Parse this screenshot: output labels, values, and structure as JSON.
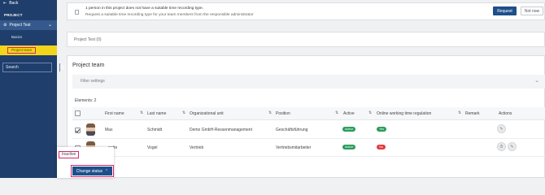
{
  "sidebar": {
    "back_label": "Back",
    "section_label": "PROJECT",
    "project_label": "Project Test",
    "basics_label": "Basics",
    "team_label": "Project team",
    "search_placeholder": "Search"
  },
  "notice": {
    "title": "1 person in this project does not have a suitable time recording type.",
    "text": "Request a suitable time recording type for your team members from the responsible administrator",
    "request_label": "Request",
    "not_now_label": "Not now"
  },
  "project_text": {
    "label": "Project Text (0)"
  },
  "team": {
    "title": "Project team",
    "filter_label": "Filter settings",
    "elements_label": "Elements: 2",
    "columns": {
      "first_name": "First name",
      "last_name": "Last name",
      "org_unit": "Organizational unit",
      "position": "Position",
      "active": "Active",
      "online_working_time": "Online working time regulation",
      "remark": "Remark",
      "actions": "Actions"
    },
    "rows": [
      {
        "first_name": "Max",
        "last_name": "Schmidt",
        "org_unit": "Demo GmbH-Ressenmanagement",
        "position": "Geschäftsführung",
        "active": "Active",
        "online": "Yes",
        "checked": true
      },
      {
        "first_name": "...nette",
        "last_name": "Vogel",
        "org_unit": "Vertrieb",
        "position": "Vertriebsmitarbeiter",
        "active": "Active",
        "online": "No",
        "checked": false
      }
    ]
  },
  "popup": {
    "inactive_label": "Inactive",
    "change_status_label": "Change status"
  },
  "colors": {
    "sidebar": "#1f3e6b",
    "highlight": "#f2d51b",
    "accent": "#1f4f8b",
    "badge_green": "#2a9d5c",
    "badge_red": "#e0383e",
    "annotation": "#d6246e"
  },
  "icons": {
    "back": "logout-arrow-icon",
    "project": "gear-icon",
    "search": "magnifier-icon",
    "filter": "chevron-down-icon",
    "sort": "sort-arrows-icon"
  }
}
